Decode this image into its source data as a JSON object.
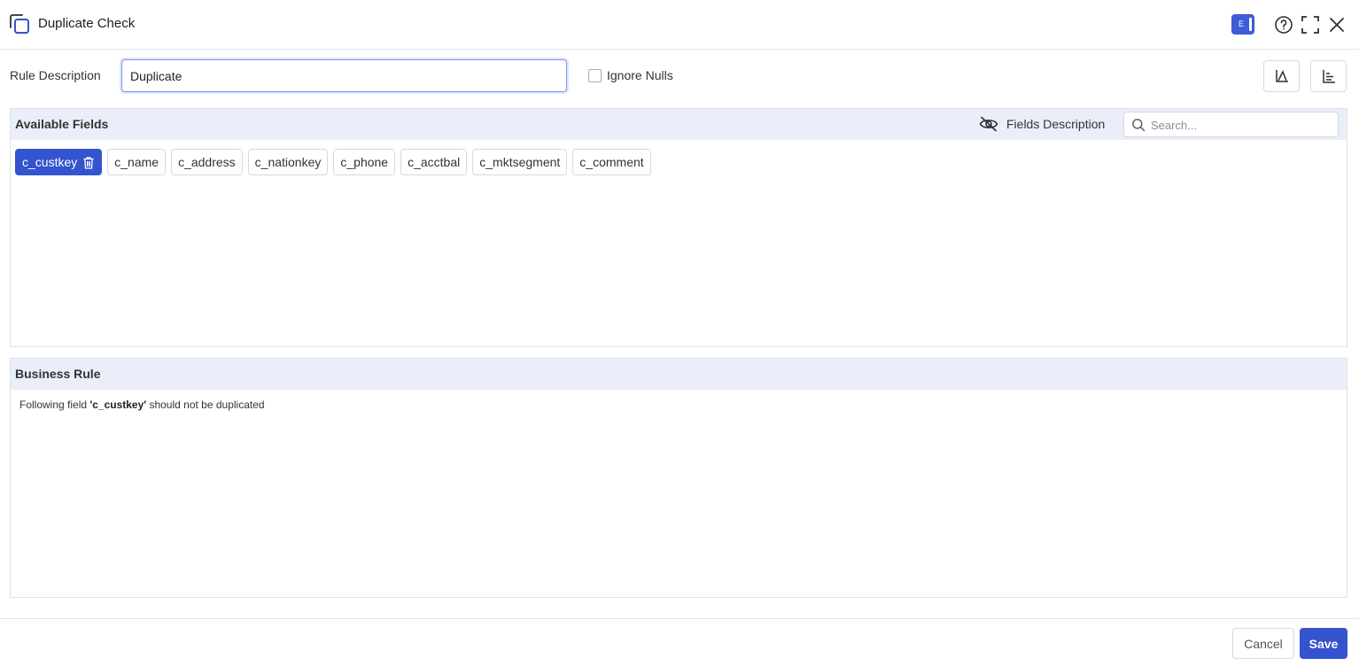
{
  "header": {
    "title": "Duplicate Check",
    "mode_badge": "E",
    "icons": [
      "duplicate-icon",
      "help-icon",
      "expand-icon",
      "close-icon"
    ]
  },
  "rule": {
    "label": "Rule Description",
    "value": "Duplicate",
    "ignore_nulls_label": "Ignore Nulls",
    "ignore_nulls_checked": false
  },
  "available_fields": {
    "title": "Available Fields",
    "fields_description_label": "Fields Description",
    "search_placeholder": "Search...",
    "fields": [
      {
        "label": "c_custkey",
        "selected": true
      },
      {
        "label": "c_name",
        "selected": false
      },
      {
        "label": "c_address",
        "selected": false
      },
      {
        "label": "c_nationkey",
        "selected": false
      },
      {
        "label": "c_phone",
        "selected": false
      },
      {
        "label": "c_acctbal",
        "selected": false
      },
      {
        "label": "c_mktsegment",
        "selected": false
      },
      {
        "label": "c_comment",
        "selected": false
      }
    ]
  },
  "business_rule": {
    "title": "Business Rule",
    "prefix": "Following field ",
    "field": "'c_custkey'",
    "suffix": " should not be duplicated"
  },
  "footer": {
    "cancel_label": "Cancel",
    "save_label": "Save"
  },
  "colors": {
    "accent": "#3453cf",
    "panel_header": "#eaeef9"
  }
}
